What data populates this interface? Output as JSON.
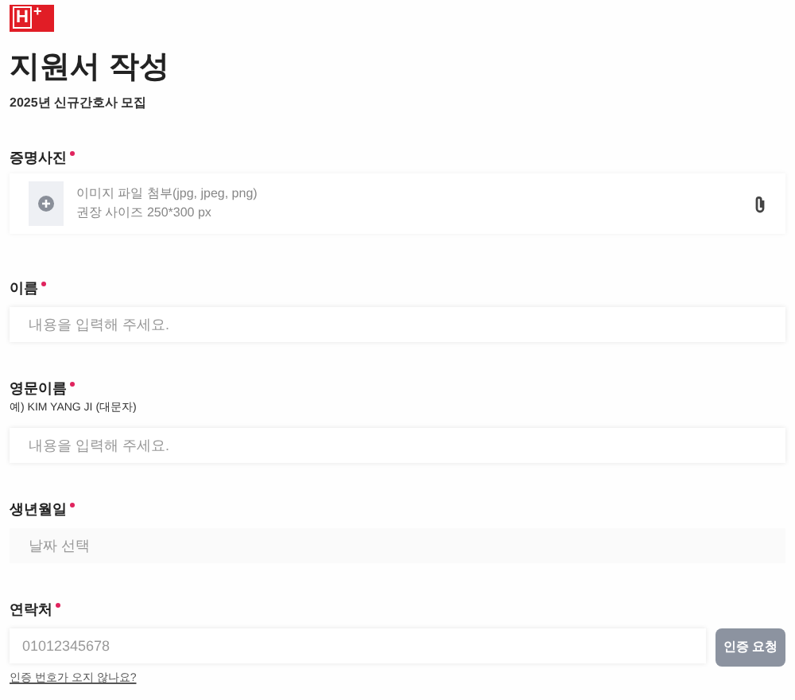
{
  "logo": {
    "letter": "H",
    "mark": "+"
  },
  "title": "지원서 작성",
  "subtitle": "2025년 신규간호사 모집",
  "fields": [
    {
      "kind": "photo",
      "label": "증명사진",
      "required": true,
      "lines": [
        "이미지 파일 첨부(jpg, jpeg, png)",
        "권장 사이즈 250*300 px"
      ]
    },
    {
      "kind": "text",
      "label": "이름",
      "required": true,
      "placeholder": "내용을 입력해 주세요."
    },
    {
      "kind": "text",
      "label": "영문이름",
      "required": true,
      "hint": "예) KIM YANG JI (대문자)",
      "placeholder": "내용을 입력해 주세요."
    },
    {
      "kind": "date",
      "label": "생년월일",
      "required": true,
      "placeholder": "날짜 선택"
    },
    {
      "kind": "phone",
      "label": "연락처",
      "required": true,
      "placeholder": "01012345678",
      "button": "인증 요청",
      "link": "인증 번호가 오지 않나요?"
    }
  ]
}
